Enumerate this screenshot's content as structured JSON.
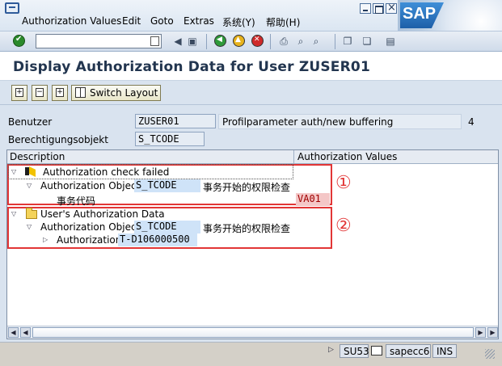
{
  "menu": {
    "items": [
      {
        "label": "Authorization Values",
        "key": "A"
      },
      {
        "label": "Edit",
        "key": "E"
      },
      {
        "label": "Goto",
        "key": "G"
      },
      {
        "label": "Extras",
        "key": "x"
      },
      {
        "label": "系统(Y)",
        "key": "Y"
      },
      {
        "label": "帮助(H)",
        "key": "H"
      }
    ],
    "logo": "SAP"
  },
  "page": {
    "title": "Display Authorization Data for User ZUSER01"
  },
  "app_toolbar": {
    "switch_layout_label": "Switch Layout"
  },
  "header_fields": {
    "user_label": "Benutzer",
    "user_value": "ZUSER01",
    "profil_text": "Profilparameter auth/new buffering",
    "profil_value": "4",
    "object_label": "Berechtigungsobjekt",
    "object_value": "S_TCODE"
  },
  "tree": {
    "columns": [
      "Description",
      "Authorization Values"
    ],
    "nodes": {
      "check_failed": "Authorization check failed",
      "auth_object_label_1": "Authorization Object",
      "auth_object_name_1": "S_TCODE",
      "auth_object_desc_1": "事务开始的权限检查",
      "field_name": "事务代码",
      "field_value": "VA01",
      "user_auth_data": "User's Authorization Data",
      "auth_object_label_2": "Authorization Object",
      "auth_object_name_2": "S_TCODE",
      "auth_object_desc_2": "事务开始的权限检查",
      "authorization_label": "Authorization",
      "authorization_value": "T-D106000500"
    },
    "markers": [
      "①",
      "②"
    ]
  },
  "status": {
    "transaction": "SU53",
    "server": "sapecc6",
    "mode": "INS"
  },
  "colors": {
    "title": "#22354f",
    "highlight_box": "#e23636",
    "selected_field": "#cfe3f8"
  }
}
